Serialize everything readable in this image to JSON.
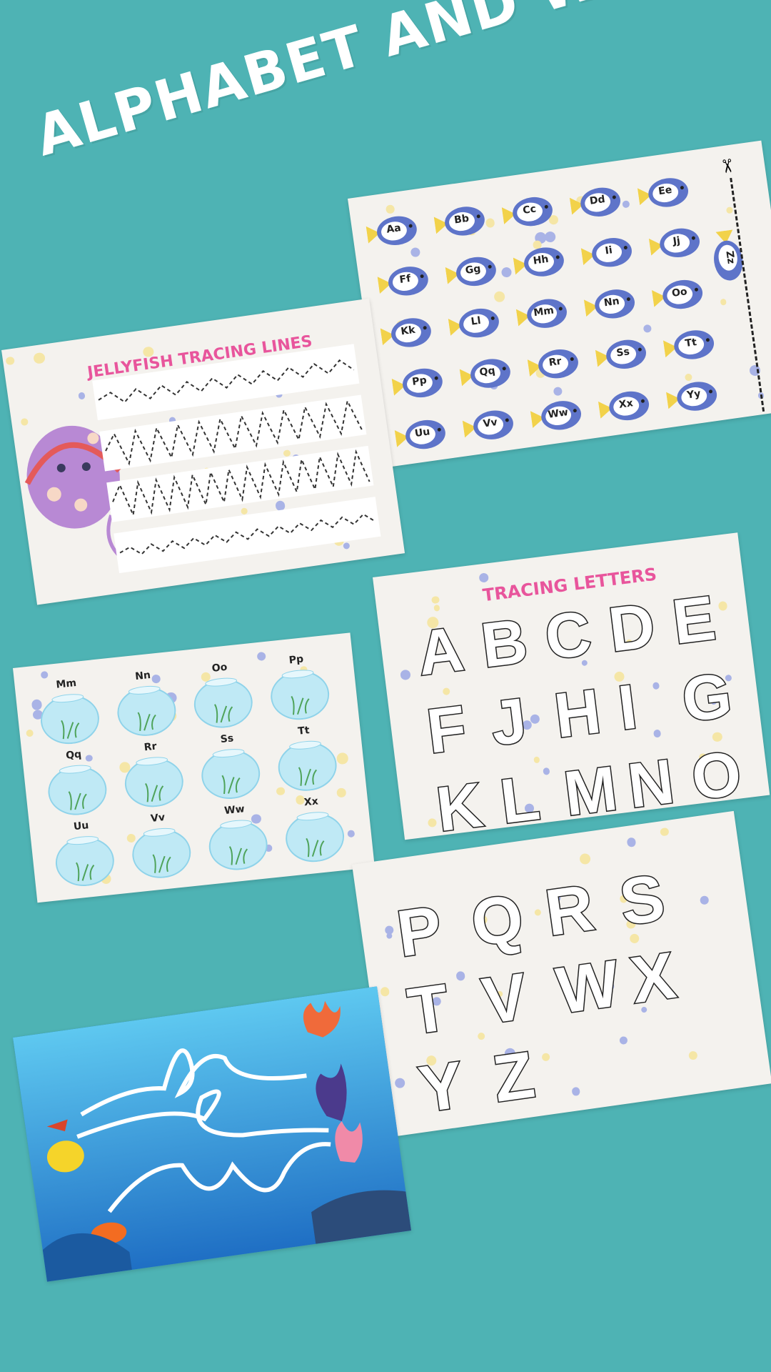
{
  "title": "ALPHABET AND WRITING",
  "colors": {
    "background": "#4eb3b4",
    "card": "#f4f2ee",
    "pink_title": "#e8559c",
    "fish_body": "#5e74c9",
    "dot_blue": "#a9b3e6",
    "dot_yellow": "#f5e6a6"
  },
  "jellyfish_card": {
    "title": "JELLYFISH TRACING LINES"
  },
  "fish_card": {
    "letters": [
      "Aa",
      "Bb",
      "Cc",
      "Dd",
      "Ee",
      "Ff",
      "Gg",
      "Hh",
      "Ii",
      "Jj",
      "Kk",
      "Ll",
      "Mm",
      "Nn",
      "Oo",
      "Pp",
      "Qq",
      "Rr",
      "Ss",
      "Tt",
      "Uu",
      "Vv",
      "Ww",
      "Xx",
      "Yy",
      "Zz"
    ],
    "scissors_icon": "scissors-icon"
  },
  "bowls_card": {
    "letters": [
      "Mm",
      "Nn",
      "Oo",
      "Pp",
      "Qq",
      "Rr",
      "Ss",
      "Tt",
      "Uu",
      "Vv",
      "Ww",
      "Xx"
    ]
  },
  "tracing_card": {
    "title": "TRACING LETTERS",
    "rows": [
      [
        "A",
        "B",
        "C",
        "D",
        "E"
      ],
      [
        "F",
        "J",
        "H",
        "I",
        "G"
      ],
      [
        "K",
        "L",
        "M",
        "N",
        "O"
      ]
    ]
  },
  "tracing_card_2": {
    "rows": [
      [
        "P",
        "Q",
        "R",
        "S"
      ],
      [
        "T",
        "V",
        "W",
        "X"
      ],
      [
        "Y",
        "Z"
      ]
    ]
  },
  "ocean_card": {
    "scene": "ocean-maze"
  }
}
